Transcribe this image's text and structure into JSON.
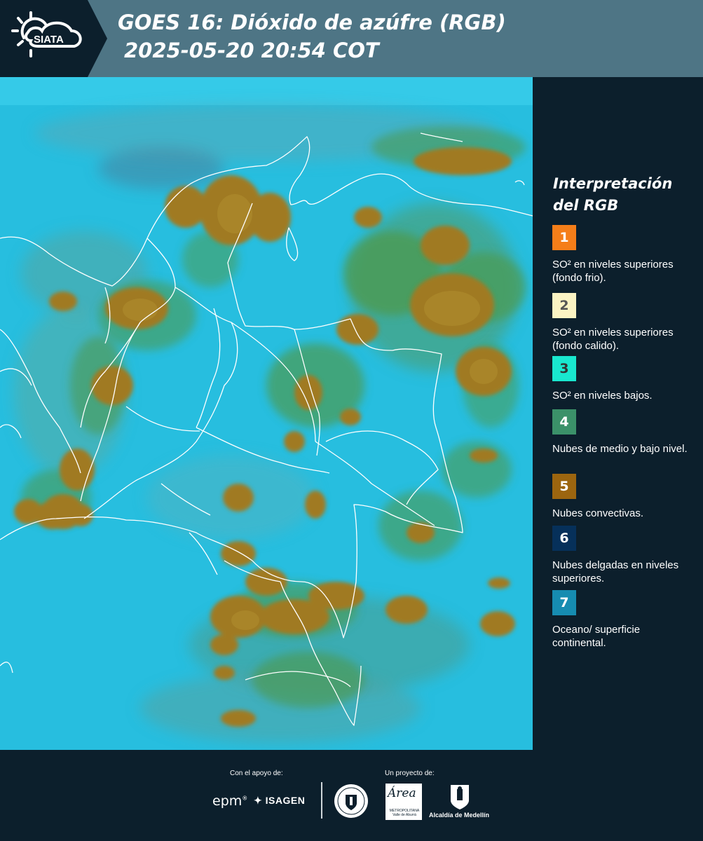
{
  "header": {
    "logo_text": "SIATA",
    "title_line1": "GOES 16: Dióxido de azúfre (RGB)",
    "title_line2": "2025-05-20 20:54 COT"
  },
  "legend": {
    "title": "Interpretación del RGB",
    "items": [
      {
        "number": "1",
        "color": "#f57e19",
        "text_color": "#ffffff",
        "label": "SO² en niveles superiores (fondo frio)."
      },
      {
        "number": "2",
        "color": "#fbf3c3",
        "text_color": "#555555",
        "label": "SO² en niveles superiores (fondo calido)."
      },
      {
        "number": "3",
        "color": "#19e7cf",
        "text_color": "#333333",
        "label": "SO² en niveles bajos."
      },
      {
        "number": "4",
        "color": "#3b9169",
        "text_color": "#ffffff",
        "label": "Nubes de medio y bajo nivel."
      },
      {
        "number": "5",
        "color": "#9c650f",
        "text_color": "#ffffff",
        "label": "Nubes convectivas."
      },
      {
        "number": "6",
        "color": "#06305a",
        "text_color": "#ffffff",
        "label": "Nubes delgadas en niveles superiores."
      },
      {
        "number": "7",
        "color": "#168cb1",
        "text_color": "#ffffff",
        "label": "Oceano/ superficie continental."
      }
    ]
  },
  "map": {
    "background_color": "#27bedf",
    "convective_color": "#a07a24",
    "midlevel_color": "#4c9a52",
    "border_color": "#ffffff"
  },
  "footer": {
    "support_label": "Con el apoyo de:",
    "project_label": "Un proyecto de:",
    "sponsor1": "epm",
    "sponsor2": "ISAGEN",
    "partner_area": "Área",
    "partner_area_sub": "METROPOLITANA Valle de Aburrá",
    "partner_alcaldia": "Alcaldía de Medellín"
  }
}
